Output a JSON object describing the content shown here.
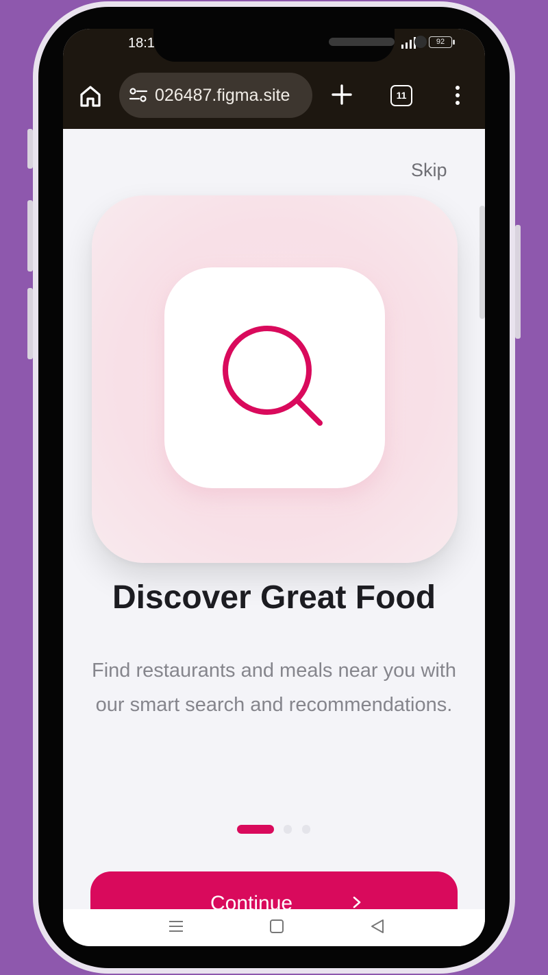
{
  "status_bar": {
    "time": "18:1",
    "battery": "92"
  },
  "browser": {
    "url": "026487.figma.site",
    "tab_count": "11",
    "icons": [
      "home-icon",
      "site-settings-icon",
      "plus-icon",
      "tabs-icon",
      "more-vert-icon"
    ]
  },
  "onboarding": {
    "skip_label": "Skip",
    "hero_icon": "search-icon",
    "title": "Discover Great Food",
    "description": "Find restaurants and meals near you with our smart search and recommendations.",
    "pagination": {
      "total": 3,
      "active": 1
    },
    "continue_label": "Continue",
    "continue_icon": "chevron-right-icon",
    "accent_color": "#d90a5c"
  },
  "system_nav": {
    "icons": [
      "menu-icon",
      "home-square-icon",
      "back-triangle-icon"
    ]
  },
  "frame": {
    "background_color": "#8e58ad"
  }
}
